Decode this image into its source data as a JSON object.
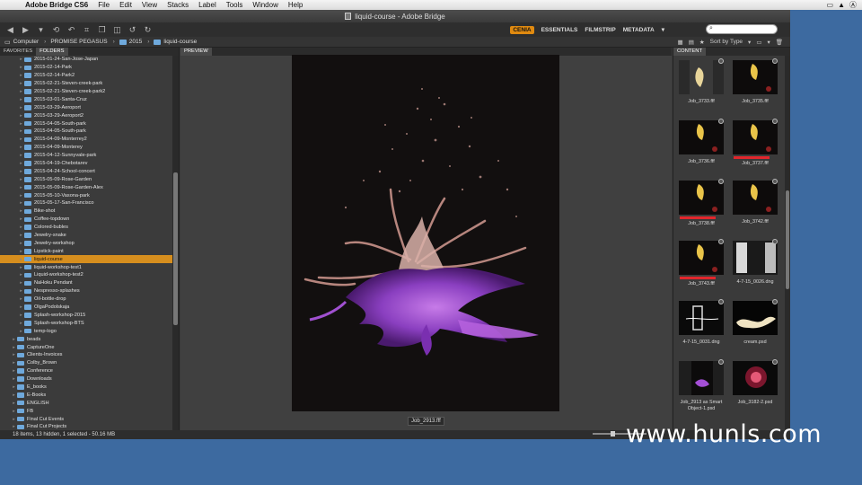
{
  "menubar": {
    "app": "Adobe Bridge CS6",
    "items": [
      "File",
      "Edit",
      "View",
      "Stacks",
      "Label",
      "Tools",
      "Window",
      "Help"
    ],
    "right_icons": [
      "screen-icon",
      "airplay-icon",
      "wifi-icon"
    ]
  },
  "window": {
    "title": "liquid-course - Adobe Bridge"
  },
  "toolbar": {
    "workspaces": [
      "CENIA",
      "ESSENTIALS",
      "FILMSTRIP",
      "METADATA"
    ],
    "active_workspace": "CENIA",
    "search_placeholder": ""
  },
  "pathbar": {
    "crumbs": [
      "Computer",
      "PROMISE PEGASUS",
      "2015",
      "liquid-course"
    ],
    "sort_label": "Sort by Type"
  },
  "left_panel": {
    "tabs": [
      "FAVORITES",
      "FOLDERS"
    ],
    "active_tab": "FOLDERS",
    "folders": [
      {
        "name": "2015-01-24-San-Jose-Japan",
        "level": 2
      },
      {
        "name": "2015-02-14-Park",
        "level": 2
      },
      {
        "name": "2015-02-14-Park2",
        "level": 2
      },
      {
        "name": "2015-02-21-Steven-creek-park",
        "level": 2
      },
      {
        "name": "2015-02-21-Steven-creek-park2",
        "level": 2
      },
      {
        "name": "2015-03-01-Santa-Cruz",
        "level": 2
      },
      {
        "name": "2015-03-29-Aeroport",
        "level": 2
      },
      {
        "name": "2015-03-29-Aeroport2",
        "level": 2
      },
      {
        "name": "2015-04-05-South-park",
        "level": 2
      },
      {
        "name": "2015-04-05-South-park",
        "level": 2
      },
      {
        "name": "2015-04-09-Monterrey2",
        "level": 2
      },
      {
        "name": "2015-04-09-Monterey",
        "level": 2
      },
      {
        "name": "2015-04-12-Sunnyvale-park",
        "level": 2
      },
      {
        "name": "2015-04-19-Chebotarev",
        "level": 2
      },
      {
        "name": "2015-04-24-School-concert",
        "level": 2
      },
      {
        "name": "2015-05-09-Rose-Garden",
        "level": 2
      },
      {
        "name": "2015-05-09-Rose-Garden-Alex",
        "level": 2
      },
      {
        "name": "2015-05-10-Vasona-park",
        "level": 2
      },
      {
        "name": "2015-05-17-San-Francisco",
        "level": 2
      },
      {
        "name": "Bike-shot",
        "level": 2
      },
      {
        "name": "Coffee-topdown",
        "level": 2
      },
      {
        "name": "Colored-bubles",
        "level": 2
      },
      {
        "name": "Jewelry-snake",
        "level": 2
      },
      {
        "name": "Jewelry-workshop",
        "level": 2
      },
      {
        "name": "Lipstick-paint",
        "level": 2
      },
      {
        "name": "liquid-course",
        "level": 2,
        "selected": true
      },
      {
        "name": "liquid-workshop-test1",
        "level": 2
      },
      {
        "name": "Liquid-workshop-test2",
        "level": 2
      },
      {
        "name": "NaHoku Pendant",
        "level": 2
      },
      {
        "name": "Nespresso-splashes",
        "level": 2
      },
      {
        "name": "Oil-bottle-drop",
        "level": 2
      },
      {
        "name": "OlgaPodolskaja",
        "level": 2
      },
      {
        "name": "Splash-workshop-2015",
        "level": 2
      },
      {
        "name": "Splash-workshop-BTS",
        "level": 2
      },
      {
        "name": "temp-logo",
        "level": 2
      },
      {
        "name": "beads",
        "level": 1
      },
      {
        "name": "CaptureOne",
        "level": 1
      },
      {
        "name": "Clients-Invoices",
        "level": 1
      },
      {
        "name": "Colby_Brown",
        "level": 1
      },
      {
        "name": "Conference",
        "level": 1
      },
      {
        "name": "Downloads",
        "level": 1
      },
      {
        "name": "E_books",
        "level": 1
      },
      {
        "name": "E-Books",
        "level": 1
      },
      {
        "name": "ENGLISH",
        "level": 1
      },
      {
        "name": "FB",
        "level": 1
      },
      {
        "name": "Final Cut Events",
        "level": 1
      },
      {
        "name": "Final Cut Projects",
        "level": 1
      }
    ]
  },
  "preview": {
    "tab": "PREVIEW",
    "caption": "Job_2913.fff"
  },
  "content": {
    "tab": "CONTENT",
    "thumbs": [
      {
        "name": "Job_3733.fff",
        "kind": "splash-yellow"
      },
      {
        "name": "Job_3735.fff",
        "kind": "splash-yellow-dark"
      },
      {
        "name": "Job_3736.fff",
        "kind": "splash-yellow-dark"
      },
      {
        "name": "Job_3737.fff",
        "kind": "splash-yellow-dark",
        "red": true
      },
      {
        "name": "Job_3738.fff",
        "kind": "splash-yellow-dark",
        "red": true
      },
      {
        "name": "Job_3742.fff",
        "kind": "splash-yellow-dark"
      },
      {
        "name": "Job_3743.fff",
        "kind": "splash-yellow-dark",
        "red": true
      },
      {
        "name": "4-7-15_0026.dng",
        "kind": "studio"
      },
      {
        "name": "4-7-15_0031.dng",
        "kind": "glass"
      },
      {
        "name": "cream.psd",
        "kind": "cream"
      },
      {
        "name": "Job_2913 as Smart Object-1.psd",
        "kind": "purple"
      },
      {
        "name": "Job_3182-2.psd",
        "kind": "red-splash"
      }
    ]
  },
  "status": {
    "text": "18 items, 13 hidden, 1 selected - 50.16 MB"
  },
  "watermark": "www.hunls.com",
  "colors": {
    "accent": "#d68e1e",
    "desktop": "#3d6aa0",
    "label_red": "#e1262c"
  }
}
